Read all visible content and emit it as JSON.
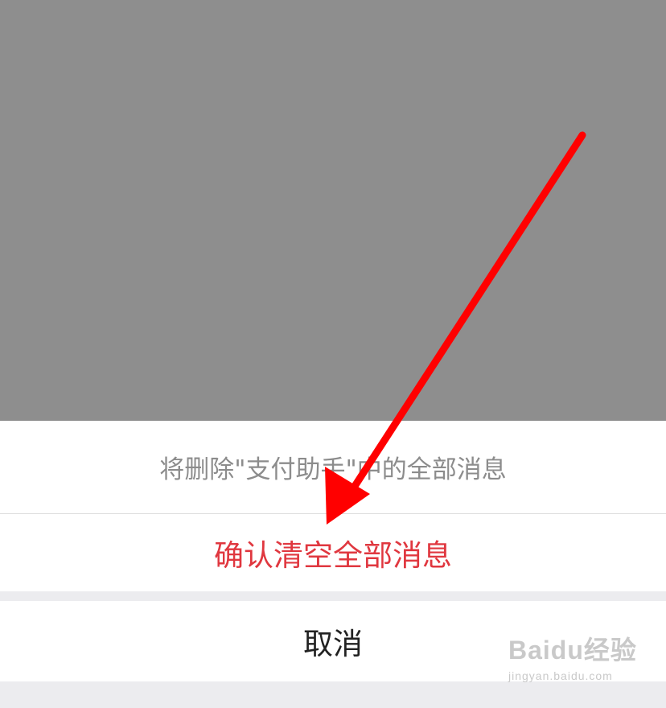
{
  "action_sheet": {
    "message": "将删除\"支付助手\"中的全部消息",
    "confirm_label": "确认清空全部消息",
    "cancel_label": "取消"
  },
  "colors": {
    "overlay": "#8e8e8e",
    "sheet_background": "#ececef",
    "message_text": "#8c8c8c",
    "confirm_text": "#e0373f",
    "cancel_text": "#222222",
    "annotation_arrow": "#ff0000"
  },
  "annotation": {
    "type": "arrow",
    "points_to": "confirm-clear-all-button"
  },
  "watermark": {
    "brand": "Baidu经验",
    "url": "jingyan.baidu.com"
  }
}
